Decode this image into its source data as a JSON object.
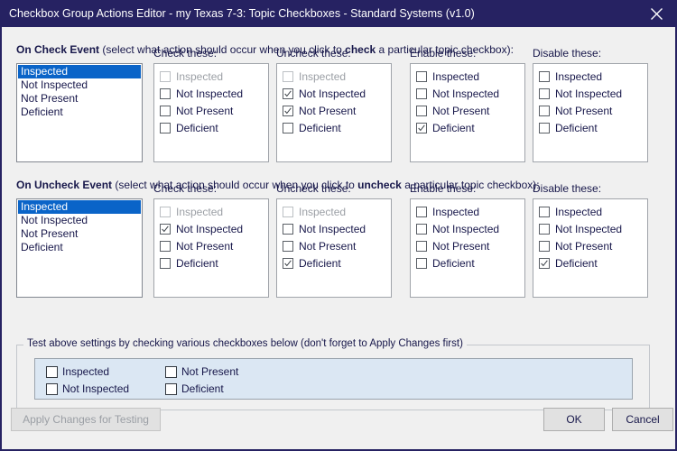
{
  "window": {
    "title": "Checkbox Group Actions Editor - my Texas 7-3: Topic Checkboxes - Standard Systems (v1.0)",
    "close_icon": "close-icon",
    "titlebar_color": "#262262",
    "body_color": "#f0f0f0",
    "selection_color": "#0a64c8",
    "test_area_color": "#dbe7f3"
  },
  "sections": [
    {
      "id": "on-check-event",
      "header_bold": "On Check Event",
      "header_rest_before": " (select what action should occur when you click to ",
      "header_bold2": "check",
      "header_rest_after": " a particular topic checkbox):",
      "listbox": {
        "items": [
          "Inspected",
          "Not Inspected",
          "Not Present",
          "Deficient"
        ],
        "selected_index": 0
      },
      "columns": [
        {
          "label": "Check these:",
          "items": [
            {
              "label": "Inspected",
              "checked": false,
              "disabled": true
            },
            {
              "label": "Not Inspected",
              "checked": false,
              "disabled": false
            },
            {
              "label": "Not Present",
              "checked": false,
              "disabled": false
            },
            {
              "label": "Deficient",
              "checked": false,
              "disabled": false
            }
          ]
        },
        {
          "label": "Uncheck these:",
          "items": [
            {
              "label": "Inspected",
              "checked": false,
              "disabled": true
            },
            {
              "label": "Not Inspected",
              "checked": true,
              "disabled": false
            },
            {
              "label": "Not Present",
              "checked": true,
              "disabled": false
            },
            {
              "label": "Deficient",
              "checked": false,
              "disabled": false
            }
          ]
        },
        {
          "label": "Enable these:",
          "items": [
            {
              "label": "Inspected",
              "checked": false,
              "disabled": false
            },
            {
              "label": "Not Inspected",
              "checked": false,
              "disabled": false
            },
            {
              "label": "Not Present",
              "checked": false,
              "disabled": false
            },
            {
              "label": "Deficient",
              "checked": true,
              "disabled": false
            }
          ]
        },
        {
          "label": "Disable these:",
          "items": [
            {
              "label": "Inspected",
              "checked": false,
              "disabled": false
            },
            {
              "label": "Not Inspected",
              "checked": false,
              "disabled": false
            },
            {
              "label": "Not Present",
              "checked": false,
              "disabled": false
            },
            {
              "label": "Deficient",
              "checked": false,
              "disabled": false
            }
          ]
        }
      ]
    },
    {
      "id": "on-uncheck-event",
      "header_bold": "On Uncheck Event",
      "header_rest_before": " (select what action should occur when you click to ",
      "header_bold2": "uncheck",
      "header_rest_after": " a particular topic checkbox):",
      "listbox": {
        "items": [
          "Inspected",
          "Not Inspected",
          "Not Present",
          "Deficient"
        ],
        "selected_index": 0
      },
      "columns": [
        {
          "label": "Check these:",
          "items": [
            {
              "label": "Inspected",
              "checked": false,
              "disabled": true
            },
            {
              "label": "Not Inspected",
              "checked": true,
              "disabled": false
            },
            {
              "label": "Not Present",
              "checked": false,
              "disabled": false
            },
            {
              "label": "Deficient",
              "checked": false,
              "disabled": false
            }
          ]
        },
        {
          "label": "Uncheck these:",
          "items": [
            {
              "label": "Inspected",
              "checked": false,
              "disabled": true
            },
            {
              "label": "Not Inspected",
              "checked": false,
              "disabled": false
            },
            {
              "label": "Not Present",
              "checked": false,
              "disabled": false
            },
            {
              "label": "Deficient",
              "checked": true,
              "disabled": false
            }
          ]
        },
        {
          "label": "Enable these:",
          "items": [
            {
              "label": "Inspected",
              "checked": false,
              "disabled": false
            },
            {
              "label": "Not Inspected",
              "checked": false,
              "disabled": false
            },
            {
              "label": "Not Present",
              "checked": false,
              "disabled": false
            },
            {
              "label": "Deficient",
              "checked": false,
              "disabled": false
            }
          ]
        },
        {
          "label": "Disable these:",
          "items": [
            {
              "label": "Inspected",
              "checked": false,
              "disabled": false
            },
            {
              "label": "Not Inspected",
              "checked": false,
              "disabled": false
            },
            {
              "label": "Not Present",
              "checked": false,
              "disabled": false
            },
            {
              "label": "Deficient",
              "checked": true,
              "disabled": false
            }
          ]
        }
      ]
    }
  ],
  "test_group": {
    "title": "Test above settings by checking various checkboxes below (don't forget to Apply Changes first)",
    "items": [
      {
        "label": "Inspected",
        "checked": false
      },
      {
        "label": "Not Present",
        "checked": false
      },
      {
        "label": "Not Inspected",
        "checked": false
      },
      {
        "label": "Deficient",
        "checked": false
      }
    ]
  },
  "footer": {
    "apply_label": "Apply Changes for Testing",
    "apply_disabled": true,
    "ok_label": "OK",
    "cancel_label": "Cancel"
  }
}
